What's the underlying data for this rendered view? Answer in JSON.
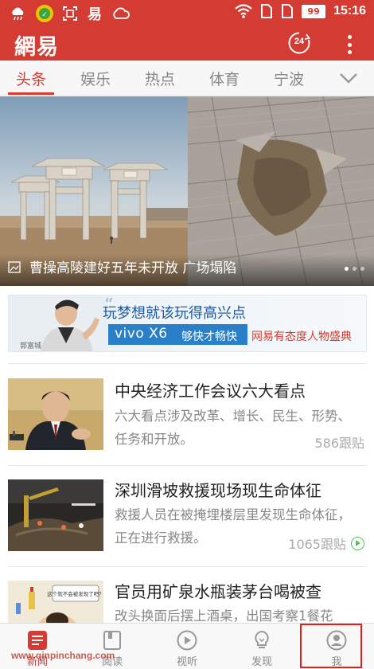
{
  "colors": {
    "brand_red": "#d43c33",
    "text_dark": "#222222",
    "text_gray": "#888888",
    "highlight_box": "#e0201c"
  },
  "status_bar": {
    "battery": "99",
    "time": "15:16",
    "left_icons": [
      "weather-cloud-icon",
      "app-badge-icon",
      "scan-icon",
      "netease-yi-icon",
      "cloud-icon"
    ],
    "right_icons": [
      "wifi-icon",
      "sim1-icon",
      "sim2-icon",
      "battery-icon"
    ]
  },
  "app_bar": {
    "logo": "網易",
    "timer_label": "24",
    "timer_icon": "clock-24-icon",
    "more_icon": "more-vertical-icon"
  },
  "tabs": {
    "items": [
      {
        "label": "头条",
        "active": true
      },
      {
        "label": "娱乐",
        "active": false
      },
      {
        "label": "热点",
        "active": false
      },
      {
        "label": "体育",
        "active": false
      },
      {
        "label": "宁波",
        "active": false
      }
    ],
    "expand_icon": "chevron-down-icon"
  },
  "hero": {
    "caption": "曹操高陵建好五年未开放 广场塌陷",
    "caption_icon": "image-gallery-icon",
    "slide_count": 3,
    "active_slide": 1
  },
  "ad": {
    "headline": "玩梦想就该玩得高兴点",
    "brand": "vivo X6",
    "slogan": "够快才畅快",
    "event": "网易有态度人物盛典",
    "signature": "郭富城"
  },
  "news": [
    {
      "title": "中央经济工作会议六大看点",
      "digest": "六大看点涉及改革、增长、民生、形势、任务和开放。",
      "replies": "586跟贴",
      "video": false
    },
    {
      "title": "深圳滑坡救援现场现生命体征",
      "digest": "救援人员在被掩埋楼层里发现生命体征，正在进行救援。",
      "replies": "1065跟贴",
      "video": true
    },
    {
      "title": "官员用矿泉水瓶装茅台喝被查",
      "digest": "改头换面后摆上酒桌，出国考察1餐花",
      "replies": "",
      "video": false,
      "thumb_text": "这个就不会被发现了吧？"
    }
  ],
  "bottom_nav": [
    {
      "label": "新闻",
      "icon": "news-icon",
      "active": true
    },
    {
      "label": "阅读",
      "icon": "read-icon",
      "active": false
    },
    {
      "label": "视听",
      "icon": "play-circle-icon",
      "active": false
    },
    {
      "label": "发现",
      "icon": "lightbulb-icon",
      "active": false
    },
    {
      "label": "我",
      "icon": "user-icon",
      "active": false
    }
  ],
  "watermark": "www.qinpinchang.com"
}
